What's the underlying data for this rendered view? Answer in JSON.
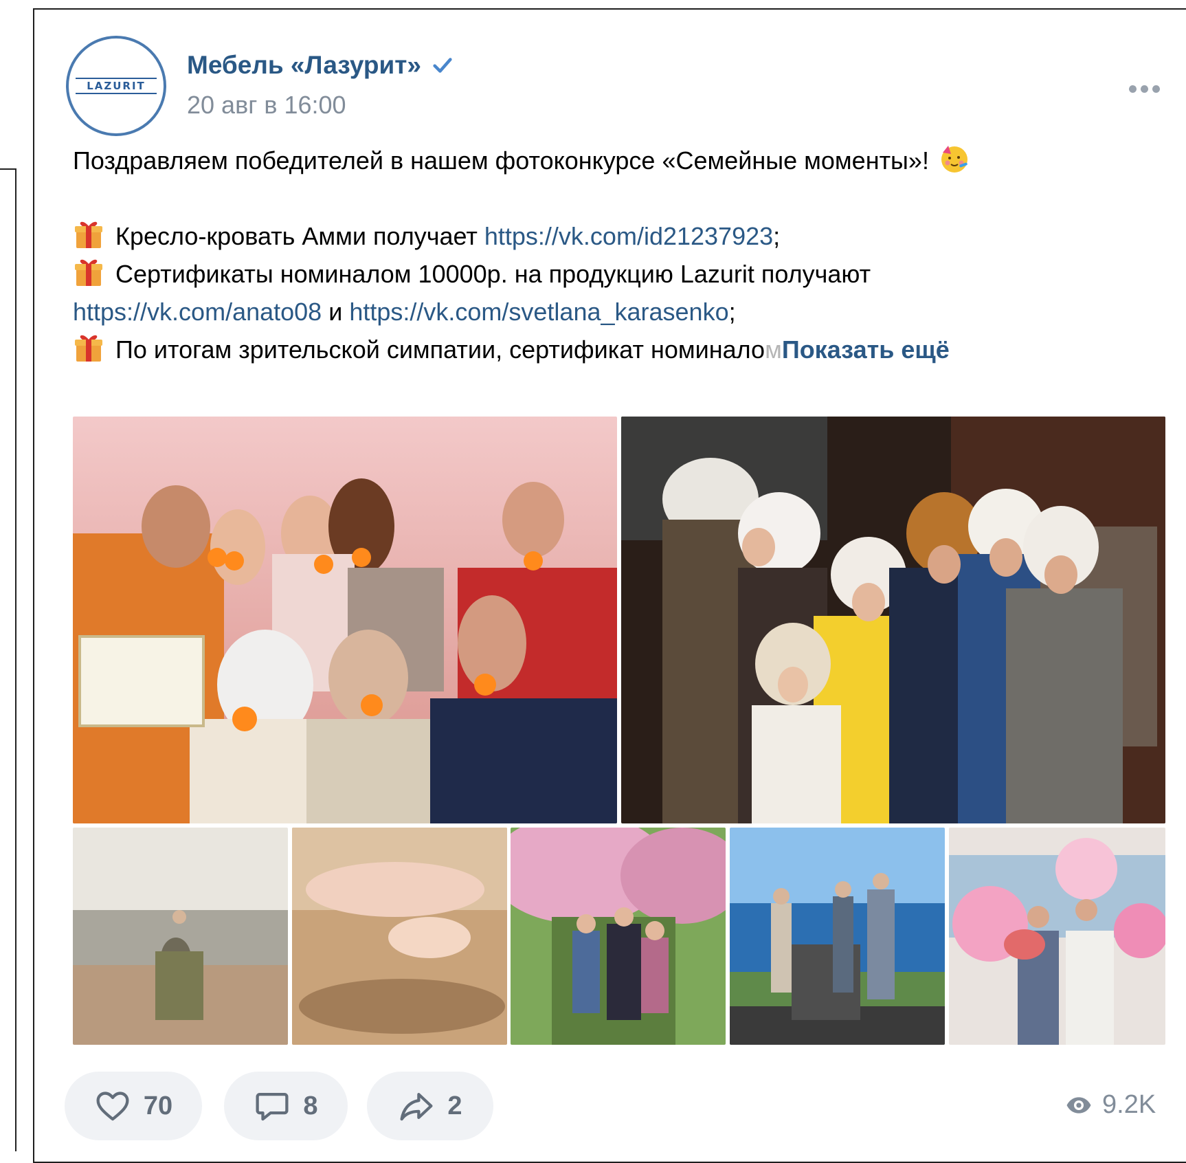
{
  "post": {
    "group_name": "Мебель «Лазурит»",
    "avatar_logo_text": "LAZURIT",
    "time": "20 авг в 16:00",
    "text": {
      "line1": "Поздравляем победителей в нашем фотоконкурсе «Семейные моменты»!",
      "line2_prefix": "Кресло-кровать Амми получает ",
      "line2_link": "https://vk.com/id21237923",
      "line2_suffix": ";",
      "line3": "Сертификаты номиналом 10000р. на продукцию Lazurit получают",
      "line4_link1": "https://vk.com/anato08",
      "line4_mid": " и ",
      "line4_link2": "https://vk.com/svetlana_karasenko",
      "line4_suffix": ";",
      "line5": "По итогам зрительской симпатии, сертификат номинало",
      "line5_faded": "м",
      "show_more": "Показать ещё"
    },
    "icons": {
      "verified": "check-icon",
      "more": "more-dots-icon",
      "gift": "gift-emoji",
      "face": "party-face-emoji"
    },
    "photos": [
      {
        "name": "family-photo-oranges"
      },
      {
        "name": "family-photo-animal-hats"
      },
      {
        "name": "photo-beach-family"
      },
      {
        "name": "photo-baby-feet-sand"
      },
      {
        "name": "photo-sakura-family"
      },
      {
        "name": "photo-sea-view-family"
      },
      {
        "name": "photo-balloons-newborn"
      }
    ],
    "actions": {
      "likes": "70",
      "comments": "8",
      "shares": "2",
      "views": "9.2K"
    },
    "colors": {
      "link": "#2a5885",
      "meta": "#818c99",
      "action_bg": "#f0f2f5"
    }
  }
}
